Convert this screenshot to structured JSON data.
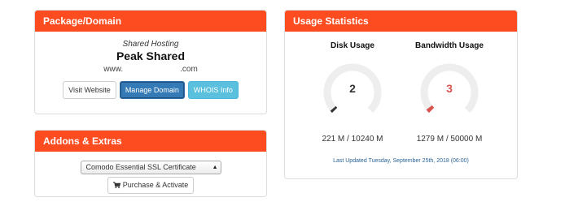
{
  "package_panel": {
    "title": "Package/Domain",
    "type": "Shared Hosting",
    "name": "Peak Shared",
    "domain_prefix": "www.",
    "domain_suffix": ".com",
    "buttons": {
      "visit": "Visit Website",
      "manage": "Manage Domain",
      "whois": "WHOIS Info"
    }
  },
  "addons_panel": {
    "title": "Addons & Extras",
    "selected_addon": "Comodo Essential SSL Certificate",
    "purchase_label": "Purchase & Activate"
  },
  "usage_panel": {
    "title": "Usage Statistics",
    "disk": {
      "title": "Disk Usage",
      "percent": 2,
      "used": "221 M / 10240 M",
      "color": "#333333"
    },
    "bandwidth": {
      "title": "Bandwidth Usage",
      "percent": 3,
      "used": "1279 M / 50000 M",
      "color": "#d9534f"
    },
    "last_updated": "Last Updated Tuesday, September 25th, 2018 (06:00)"
  },
  "colors": {
    "heading": "#fd4c1f",
    "primary": "#337ab7",
    "info": "#5bc0de",
    "gauge_track": "#eeeeee"
  }
}
